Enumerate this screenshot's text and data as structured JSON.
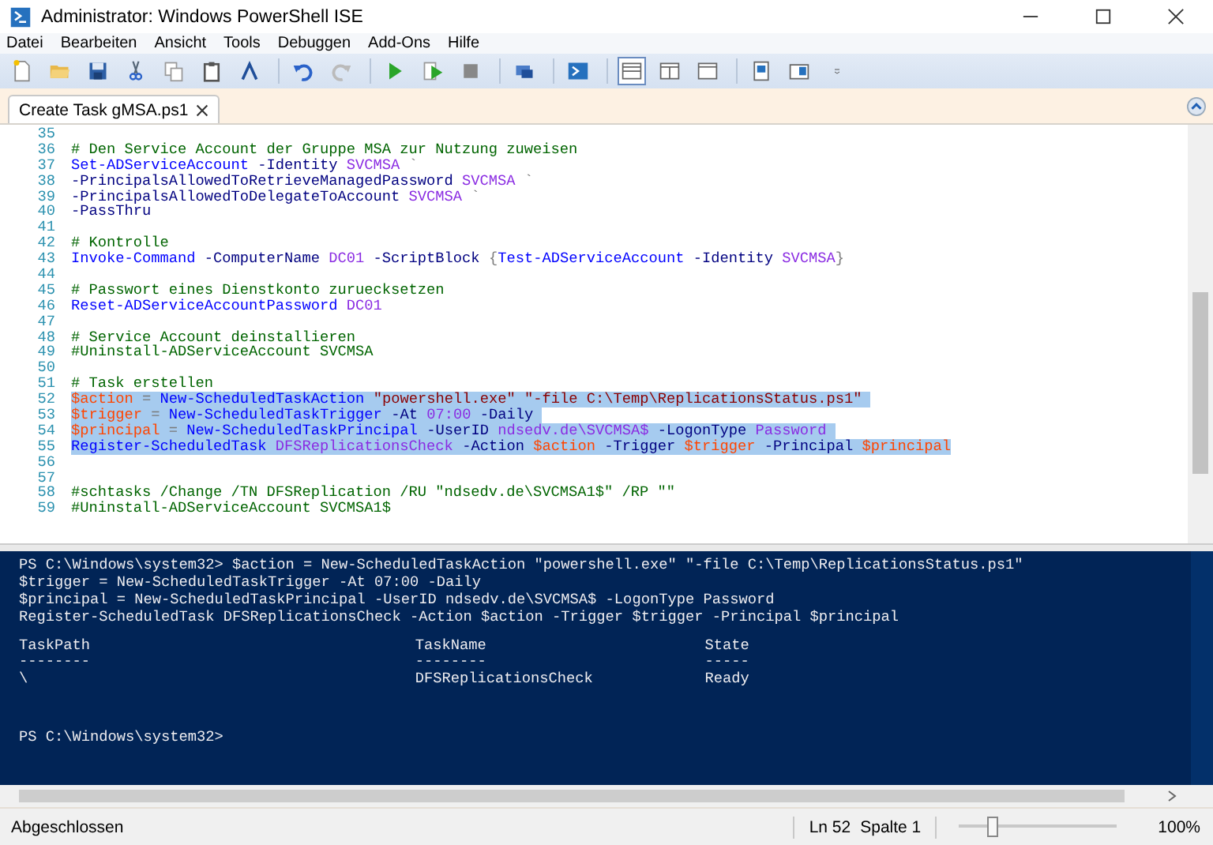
{
  "window": {
    "title": "Administrator: Windows PowerShell ISE"
  },
  "menu": [
    "Datei",
    "Bearbeiten",
    "Ansicht",
    "Tools",
    "Debuggen",
    "Add-Ons",
    "Hilfe"
  ],
  "toolbar": [
    {
      "kind": "new"
    },
    {
      "kind": "open"
    },
    {
      "kind": "save"
    },
    {
      "kind": "cut"
    },
    {
      "kind": "copy"
    },
    {
      "kind": "paste"
    },
    {
      "kind": "clear"
    },
    {
      "kind": "separator"
    },
    {
      "kind": "undo"
    },
    {
      "kind": "redo"
    },
    {
      "kind": "separator"
    },
    {
      "kind": "run"
    },
    {
      "kind": "run-selection"
    },
    {
      "kind": "stop"
    },
    {
      "kind": "separator"
    },
    {
      "kind": "remote"
    },
    {
      "kind": "separator"
    },
    {
      "kind": "shell"
    },
    {
      "kind": "separator"
    },
    {
      "kind": "layout-top",
      "selected": true
    },
    {
      "kind": "layout-right",
      "selected": false
    },
    {
      "kind": "layout-max",
      "selected": false
    },
    {
      "kind": "separator"
    },
    {
      "kind": "show-script"
    },
    {
      "kind": "show-console"
    },
    {
      "kind": "overflow"
    }
  ],
  "tabs": [
    {
      "label": "Create Task gMSA.ps1",
      "selected": true
    }
  ],
  "editor": {
    "lines": [
      {
        "number": "35",
        "selected": false
      },
      {
        "number": "36",
        "selected": false,
        "tokens": [
          {
            "kind": "comment",
            "text": "# Den Service Account der Gruppe MSA zur Nutzung zuweisen"
          }
        ]
      },
      {
        "number": "37",
        "selected": false,
        "tokens": [
          {
            "kind": "cmdlet",
            "text": "Set-ADServiceAccount"
          },
          {
            "kind": "param",
            "text": " -Identity"
          },
          {
            "kind": "argument",
            "text": " SVCMSA"
          },
          {
            "kind": "operator",
            "text": " `"
          }
        ]
      },
      {
        "number": "38",
        "selected": false,
        "tokens": [
          {
            "kind": "param",
            "text": "-PrincipalsAllowedToRetrieveManagedPassword"
          },
          {
            "kind": "argument",
            "text": " SVCMSA"
          },
          {
            "kind": "operator",
            "text": " `"
          }
        ]
      },
      {
        "number": "39",
        "selected": false,
        "tokens": [
          {
            "kind": "param",
            "text": "-PrincipalsAllowedToDelegateToAccount"
          },
          {
            "kind": "argument",
            "text": " SVCMSA"
          },
          {
            "kind": "operator",
            "text": " `"
          }
        ]
      },
      {
        "number": "40",
        "selected": false,
        "tokens": [
          {
            "kind": "param",
            "text": "-PassThru"
          }
        ]
      },
      {
        "number": "41",
        "selected": false
      },
      {
        "number": "42",
        "selected": false,
        "tokens": [
          {
            "kind": "comment",
            "text": "# Kontrolle"
          }
        ]
      },
      {
        "number": "43",
        "selected": false,
        "tokens": [
          {
            "kind": "cmdlet",
            "text": "Invoke-Command"
          },
          {
            "kind": "param",
            "text": " -ComputerName"
          },
          {
            "kind": "argument",
            "text": " DC01"
          },
          {
            "kind": "param",
            "text": " -ScriptBlock"
          },
          {
            "kind": "operator",
            "text": " {"
          },
          {
            "kind": "cmdlet",
            "text": "Test-ADServiceAccount"
          },
          {
            "kind": "param",
            "text": " -Identity"
          },
          {
            "kind": "argument",
            "text": " SVCMSA"
          },
          {
            "kind": "operator",
            "text": "}"
          }
        ]
      },
      {
        "number": "44",
        "selected": false
      },
      {
        "number": "45",
        "selected": false,
        "tokens": [
          {
            "kind": "comment",
            "text": "# Passwort eines Dienstkonto zuruecksetzen"
          }
        ]
      },
      {
        "number": "46",
        "selected": false,
        "tokens": [
          {
            "kind": "cmdlet",
            "text": "Reset-ADServiceAccountPassword"
          },
          {
            "kind": "argument",
            "text": " DC01"
          }
        ]
      },
      {
        "number": "47",
        "selected": false
      },
      {
        "number": "48",
        "selected": false,
        "tokens": [
          {
            "kind": "comment",
            "text": "# Service Account deinstallieren"
          }
        ]
      },
      {
        "number": "49",
        "selected": false,
        "tokens": [
          {
            "kind": "comment",
            "text": "#Uninstall-ADServiceAccount SVCMSA"
          }
        ]
      },
      {
        "number": "50",
        "selected": false
      },
      {
        "number": "51",
        "selected": false,
        "tokens": [
          {
            "kind": "comment",
            "text": "# Task erstellen"
          }
        ]
      },
      {
        "number": "52",
        "selected": true,
        "tokens": [
          {
            "kind": "variable",
            "text": "$action"
          },
          {
            "kind": "operator",
            "text": " ="
          },
          {
            "kind": "cmdlet",
            "text": " New-ScheduledTaskAction"
          },
          {
            "kind": "string",
            "text": " \"powershell.exe\""
          },
          {
            "kind": "string",
            "text": " \"-file C:\\Temp\\ReplicationsStatus.ps1\" "
          }
        ]
      },
      {
        "number": "53",
        "selected": true,
        "tokens": [
          {
            "kind": "variable",
            "text": "$trigger"
          },
          {
            "kind": "operator",
            "text": " ="
          },
          {
            "kind": "cmdlet",
            "text": " New-ScheduledTaskTrigger"
          },
          {
            "kind": "param",
            "text": " -At"
          },
          {
            "kind": "argument",
            "text": " 07:00"
          },
          {
            "kind": "param",
            "text": " -Daily "
          }
        ]
      },
      {
        "number": "54",
        "selected": true,
        "tokens": [
          {
            "kind": "variable",
            "text": "$principal"
          },
          {
            "kind": "operator",
            "text": " ="
          },
          {
            "kind": "cmdlet",
            "text": " New-ScheduledTaskPrincipal"
          },
          {
            "kind": "param",
            "text": " -UserID"
          },
          {
            "kind": "argument",
            "text": " ndsedv.de\\SVCMSA$"
          },
          {
            "kind": "param",
            "text": " -LogonType"
          },
          {
            "kind": "argument",
            "text": " Password "
          }
        ]
      },
      {
        "number": "55",
        "selected": true,
        "tokens": [
          {
            "kind": "cmdlet",
            "text": "Register-ScheduledTask"
          },
          {
            "kind": "argument",
            "text": " DFSReplicationsCheck"
          },
          {
            "kind": "param",
            "text": " -Action"
          },
          {
            "kind": "variable",
            "text": " $action"
          },
          {
            "kind": "param",
            "text": " -Trigger"
          },
          {
            "kind": "variable",
            "text": " $trigger"
          },
          {
            "kind": "param",
            "text": " -Principal"
          },
          {
            "kind": "variable",
            "text": " $principal"
          }
        ]
      },
      {
        "number": "56",
        "selected": false
      },
      {
        "number": "57",
        "selected": false
      },
      {
        "number": "58",
        "selected": false,
        "tokens": [
          {
            "kind": "comment",
            "text": "#schtasks /Change /TN DFSReplication /RU \"ndsedv.de\\SVCMSA1$\" /RP \"\""
          }
        ]
      },
      {
        "number": "59",
        "selected": false,
        "tokens": [
          {
            "kind": "comment",
            "text": "#Uninstall-ADServiceAccount SVCMSA1$"
          }
        ]
      }
    ]
  },
  "console": {
    "lines": [
      "PS C:\\Windows\\system32> $action = New-ScheduledTaskAction \"powershell.exe\" \"-file C:\\Temp\\ReplicationsStatus.ps1\"",
      "$trigger = New-ScheduledTaskTrigger -At 07:00 -Daily",
      "$principal = New-ScheduledTaskPrincipal -UserID ndsedv.de\\SVCMSA$ -LogonType Password",
      "Register-ScheduledTask DFSReplicationsCheck -Action $action -Trigger $trigger -Principal $principal"
    ],
    "table": {
      "columns": [
        "TaskPath",
        "TaskName",
        "State"
      ],
      "underlines": [
        "--------",
        "--------",
        "-----"
      ],
      "rows": [
        [
          "\\",
          "DFSReplicationsCheck",
          "Ready"
        ]
      ]
    },
    "prompt": "PS C:\\Windows\\system32>"
  },
  "status_bar": {
    "status": "Abgeschlossen",
    "line": "Ln 52",
    "column": "Spalte 1",
    "zoom": {
      "level": 0.22,
      "reading": "100%"
    }
  }
}
